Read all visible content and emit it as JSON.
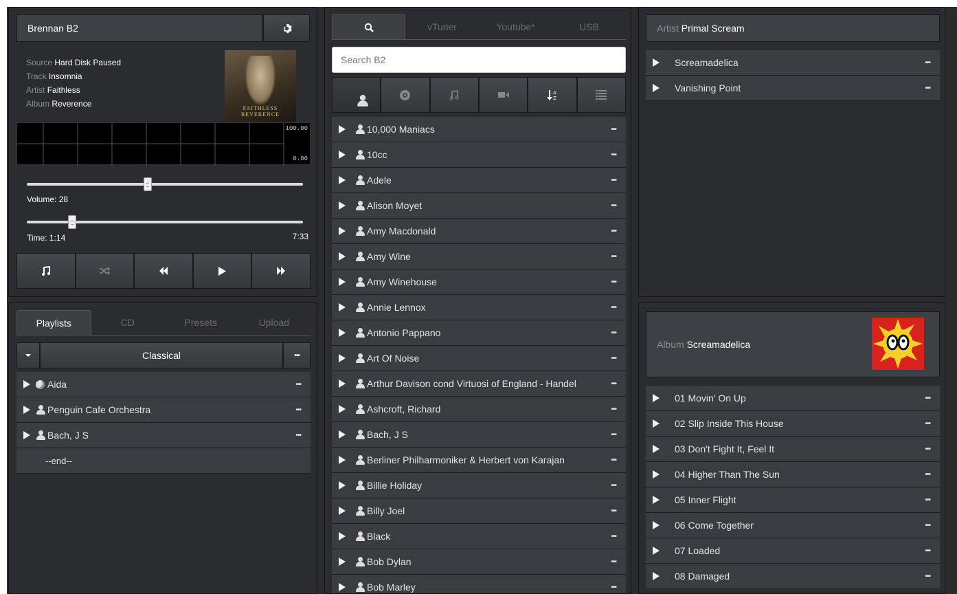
{
  "player": {
    "title": "Brennan B2",
    "source_label": "Source",
    "source_value": "Hard Disk Paused",
    "track_label": "Track",
    "track_value": "Insomnia",
    "artist_label": "Artist",
    "artist_value": "Faithless",
    "album_label": "Album",
    "album_value": "Reverence",
    "album_art_text": "FAITHLESS\nREVERENCE",
    "meter_top": "100.00",
    "meter_bottom": "0.00",
    "volume_text": "Volume: 28",
    "volume_value": 28,
    "time_text": "Time: 1:14",
    "total_time": "7:33",
    "time_fraction": 0.163
  },
  "playlists": {
    "tabs": [
      "Playlists",
      "CD",
      "Presets",
      "Upload"
    ],
    "selected": "Classical",
    "items": [
      {
        "icon": "globe-icon",
        "name": "Aida"
      },
      {
        "icon": "person-icon",
        "name": "Penguin Cafe Orchestra"
      },
      {
        "icon": "person-icon",
        "name": "Bach, J S"
      }
    ],
    "end_label": "--end--"
  },
  "browser": {
    "tabs": [
      "vTuner",
      "Youtube*",
      "USB"
    ],
    "search_placeholder": "Search B2",
    "filter_icons": [
      "person-icon",
      "disc-icon",
      "music-note-icon",
      "video-icon",
      "sort-icon",
      "list-icon"
    ],
    "artists": [
      "10,000 Maniacs",
      "10cc",
      "Adele",
      "Alison Moyet",
      "Amy Macdonald",
      "Amy Wine",
      "Amy Winehouse",
      "Annie Lennox",
      "Antonio Pappano",
      "Art Of Noise",
      "Arthur Davison cond Virtuosi of England - Handel",
      "Ashcroft, Richard",
      "Bach, J S",
      "Berliner Philharmoniker & Herbert von Karajan",
      "Billie Holiday",
      "Billy Joel",
      "Black",
      "Bob Dylan",
      "Bob Marley"
    ]
  },
  "artist_panel": {
    "label": "Artist",
    "name": "Primal Scream",
    "albums": [
      "Screamadelica",
      "Vanishing Point"
    ]
  },
  "album_panel": {
    "label": "Album",
    "name": "Screamadelica",
    "tracks": [
      "01 Movin' On Up",
      "02 Slip Inside This House",
      "03 Don't Fight It, Feel It",
      "04 Higher Than The Sun",
      "05 Inner Flight",
      "06 Come Together",
      "07 Loaded",
      "08 Damaged"
    ]
  },
  "colors": {
    "bg": "#2b2b2d",
    "row": "#393c40",
    "header": "#3d4044"
  }
}
